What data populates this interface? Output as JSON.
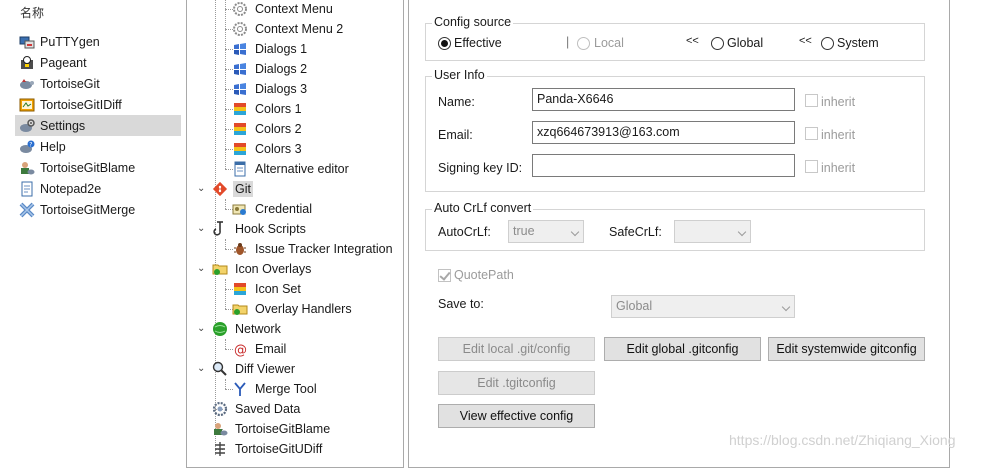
{
  "left_pane": {
    "header": "名称",
    "items": [
      {
        "label": "PuTTYgen",
        "icon": "puttygen-icon"
      },
      {
        "label": "Pageant",
        "icon": "pageant-icon"
      },
      {
        "label": "TortoiseGit",
        "icon": "tortoisegit-icon"
      },
      {
        "label": "TortoiseGitIDiff",
        "icon": "tortoisegit-idiff-icon"
      },
      {
        "label": "Settings",
        "icon": "settings-icon",
        "selected": true
      },
      {
        "label": "Help",
        "icon": "help-icon"
      },
      {
        "label": "TortoiseGitBlame",
        "icon": "blame-icon"
      },
      {
        "label": "Notepad2e",
        "icon": "notepad-icon"
      },
      {
        "label": "TortoiseGitMerge",
        "icon": "merge-icon"
      }
    ]
  },
  "tree": {
    "context_menu": "Context Menu",
    "context_menu_2": "Context Menu 2",
    "dialogs_1": "Dialogs 1",
    "dialogs_2": "Dialogs 2",
    "dialogs_3": "Dialogs 3",
    "colors_1": "Colors 1",
    "colors_2": "Colors 2",
    "colors_3": "Colors 3",
    "alternative_editor": "Alternative editor",
    "git": "Git",
    "credential": "Credential",
    "hook_scripts": "Hook Scripts",
    "issue_tracker": "Issue Tracker Integration",
    "icon_overlays": "Icon Overlays",
    "icon_set": "Icon Set",
    "overlay_handlers": "Overlay Handlers",
    "network": "Network",
    "email": "Email",
    "diff_viewer": "Diff Viewer",
    "merge_tool": "Merge Tool",
    "saved_data": "Saved Data",
    "blame": "TortoiseGitBlame",
    "udiff": "TortoiseGitUDiff"
  },
  "config_source": {
    "title": "Config source",
    "effective": "Effective",
    "local": "Local",
    "global": "Global",
    "system": "System",
    "arrow": "<<",
    "selected": "Effective"
  },
  "user_info": {
    "title": "User Info",
    "name_label": "Name:",
    "name_value": "Panda-X6646",
    "email_label": "Email:",
    "email_value": "xzq664673913@163.com",
    "signing_label": "Signing key ID:",
    "signing_value": "",
    "inherit": "inherit"
  },
  "crlf": {
    "title": "Auto CrLf convert",
    "autocrlf_label": "AutoCrLf:",
    "autocrlf_value": "true",
    "safecrlf_label": "SafeCrLf:",
    "safecrlf_value": ""
  },
  "quotepath": {
    "label": "QuotePath",
    "checked": true
  },
  "save_to": {
    "label": "Save to:",
    "value": "Global"
  },
  "buttons": {
    "edit_local": "Edit local .git/config",
    "edit_global": "Edit global .gitconfig",
    "edit_systemwide": "Edit systemwide gitconfig",
    "edit_tgit": "Edit .tgitconfig",
    "view_effective": "View effective config"
  },
  "watermark": "https://blog.csdn.net/Zhiqiang_Xiong"
}
